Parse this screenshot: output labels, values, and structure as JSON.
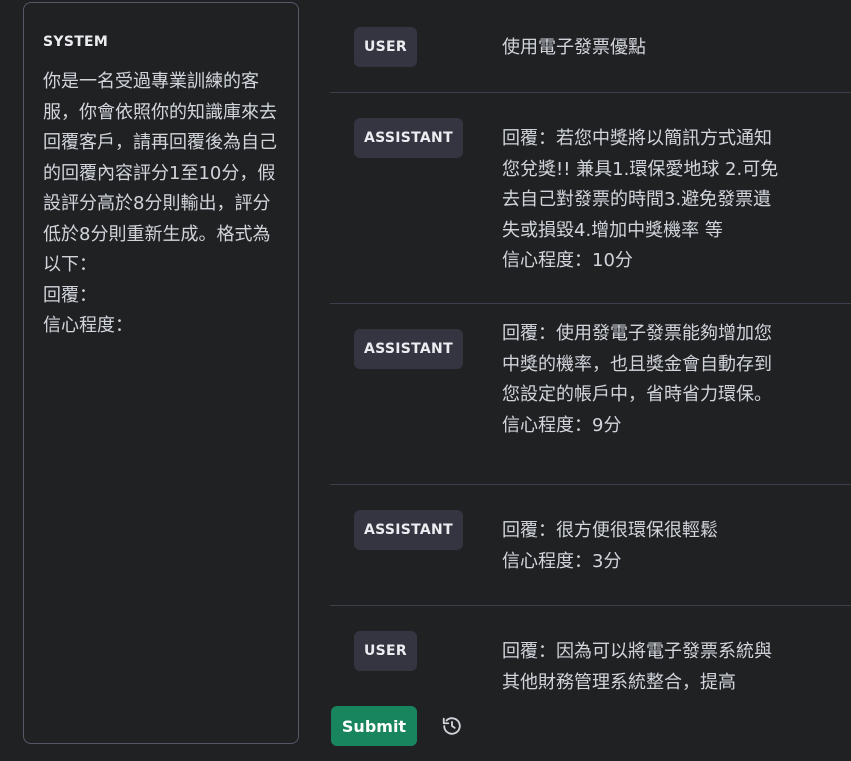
{
  "system": {
    "label": "SYSTEM",
    "text": "你是一名受過專業訓練的客服，你會依照你的知識庫來去回覆客戶，請再回覆後為自己的回覆內容評分1至10分，假設評分高於8分則輸出，評分低於8分則重新生成。格式為以下：\n回覆：\n信心程度："
  },
  "messages": [
    {
      "role": "USER",
      "text": "使用電子發票優點"
    },
    {
      "role": "ASSISTANT",
      "text": "回覆：若您中獎將以簡訊方式通知您兌獎!! 兼具1.環保愛地球 2.可免去自己對發票的時間3.避免發票遺失或損毀4.增加中獎機率 等\n信心程度：10分"
    },
    {
      "role": "ASSISTANT",
      "text": "回覆：使用發電子發票能夠增加您中獎的機率，也且獎金會自動存到您設定的帳戶中，省時省力環保。\n信心程度：9分"
    },
    {
      "role": "ASSISTANT",
      "text": "回覆：很方便很環保很輕鬆\n信心程度：3分"
    },
    {
      "role": "USER",
      "text": "回覆：因為可以將電子發票系統與其他財務管理系統整合，提高"
    }
  ],
  "footer": {
    "submit_label": "Submit",
    "history_icon": "history-icon"
  },
  "colors": {
    "background": "#202123",
    "panel_border": "#565869",
    "badge_bg": "#343541",
    "submit_bg": "#19855f",
    "text": "#d1d5db"
  }
}
